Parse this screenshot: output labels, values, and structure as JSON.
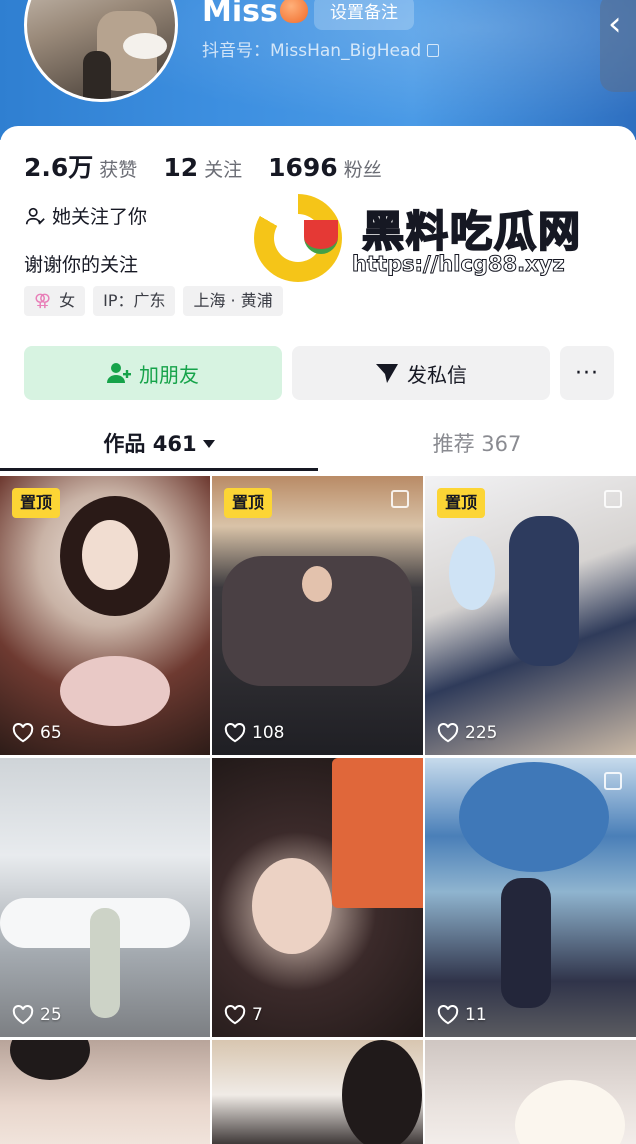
{
  "profile": {
    "nickname": "Miss",
    "remark_button": "设置备注",
    "douyin_id": "抖音号：MissHan_BigHead"
  },
  "stats": [
    {
      "value": "2.6万",
      "label": "获赞"
    },
    {
      "value": "12",
      "label": "关注"
    },
    {
      "value": "1696",
      "label": "粉丝"
    }
  ],
  "follow_status": "她关注了你",
  "bio": "谢谢你的关注",
  "tags": {
    "gender_symbol": "⚢",
    "gender": "女",
    "ip": "IP：广东",
    "location": "上海 · 黄浦"
  },
  "actions": {
    "add_friend": "加朋友",
    "message": "发私信",
    "more": "···"
  },
  "tabs": {
    "works_label": "作品 461",
    "recommend_label": "推荐 367"
  },
  "pinned_label": "置顶",
  "videos": [
    {
      "likes": "65",
      "pinned": true
    },
    {
      "likes": "108",
      "pinned": true
    },
    {
      "likes": "225",
      "pinned": true
    },
    {
      "likes": "25",
      "pinned": false
    },
    {
      "likes": "7",
      "pinned": false
    },
    {
      "likes": "11",
      "pinned": false
    }
  ],
  "watermark": {
    "title": "黑料吃瓜网",
    "url": "https://hlcg88.xyz"
  },
  "colors": {
    "header_blue": "#3d8fe0",
    "pin_yellow": "#fcd535",
    "add_friend_green": "#16a34a"
  }
}
